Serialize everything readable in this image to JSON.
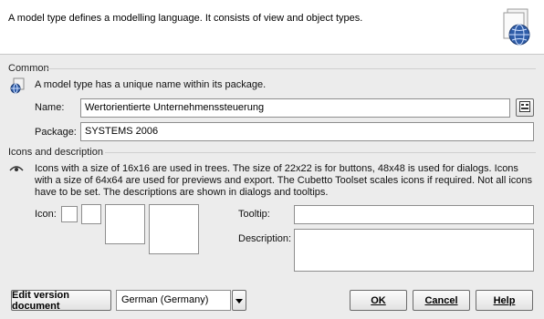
{
  "banner": {
    "description": "A model type defines a modelling language. It consists of view and object types.",
    "icon": "globe-page-icon"
  },
  "common": {
    "section_label": "Common",
    "hint_icon": "model-type-icon",
    "hint_text": "A model type has a unique name within its package.",
    "name_label": "Name:",
    "name_value": "Wertorientierte Unternehmenssteuerung",
    "name_button_icon": "translate-icon",
    "package_label": "Package:",
    "package_value": "SYSTEMS 2006"
  },
  "icons": {
    "section_label": "Icons and description",
    "hint_icon": "eye-icon",
    "hint_text": "Icons with a size of 16x16 are used in trees. The size of 22x22 is for buttons, 48x48 is used for dialogs. Icons with a size of 64x64 are used for previews and export. The Cubetto Toolset scales icons if required. Not all icons have to be set. The descriptions are shown in dialogs and tooltips.",
    "icon_label": "Icon:",
    "tooltip_label": "Tooltip:",
    "tooltip_value": "",
    "description_label": "Description:",
    "description_value": ""
  },
  "footer": {
    "edit_version_label": "Edit version document",
    "language_value": "German (Germany)",
    "ok_label": "OK",
    "cancel_label": "Cancel",
    "help_label": "Help"
  }
}
